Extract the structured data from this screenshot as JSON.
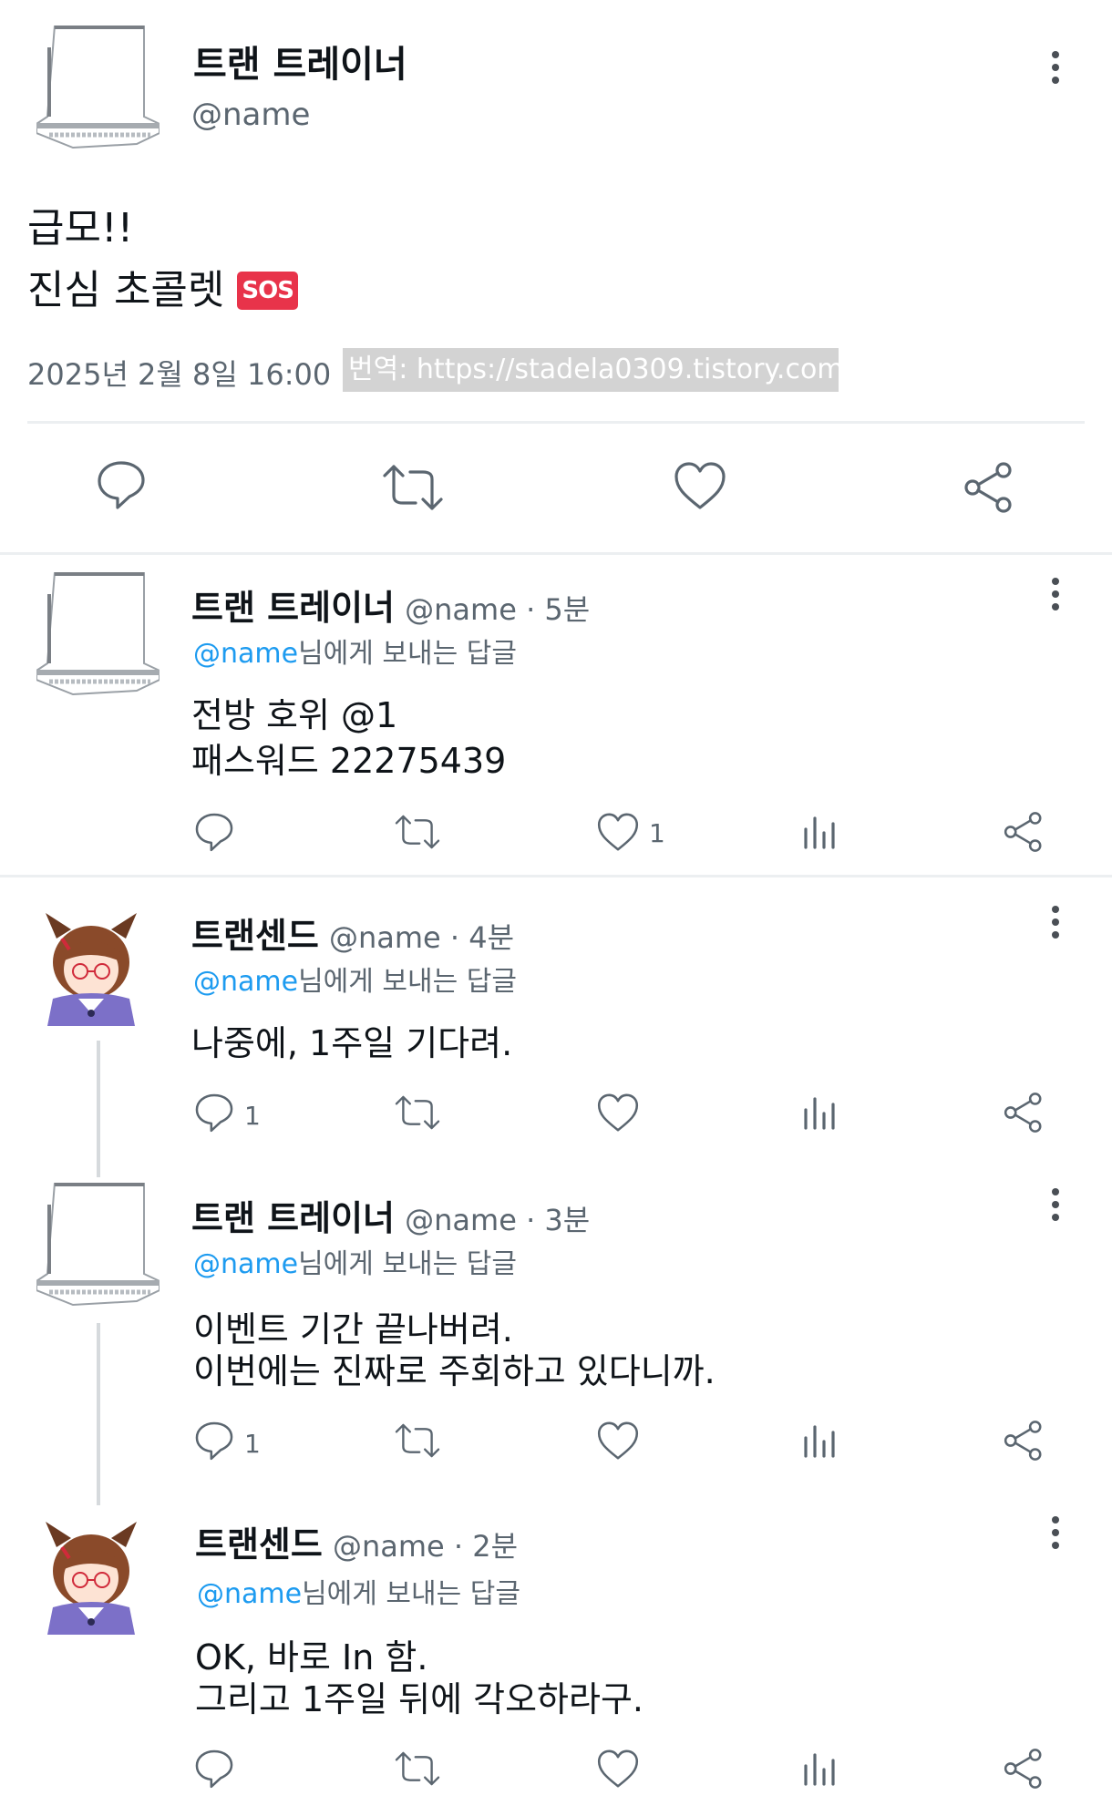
{
  "main_tweet": {
    "author_name": "트랜 트레이너",
    "author_handle": "@name",
    "text_line1": "급모!!",
    "text_line2": "진심 초콜렛",
    "sos_emoji": "SOS",
    "timestamp": "2025년 2월 8일 16:00",
    "watermark": "번역: https://stadela0309.tistory.com"
  },
  "replies": [
    {
      "author_name": "트랜 트레이너",
      "meta": "@name · 5분",
      "reply_to_handle": "@name",
      "reply_to_suffix": "님에게 보내는 답글",
      "line1": "전방 호위 @1",
      "line2": "패스워드 22275439",
      "reply_count": "",
      "like_count": "1"
    },
    {
      "author_name": "트랜센드",
      "meta": "@name · 4분",
      "reply_to_handle": "@name",
      "reply_to_suffix": "님에게 보내는 답글",
      "line1": "나중에, 1주일 기다려.",
      "line2": "",
      "reply_count": "1",
      "like_count": ""
    },
    {
      "author_name": "트랜 트레이너",
      "meta": "@name · 3분",
      "reply_to_handle": "@name",
      "reply_to_suffix": "님에게 보내는 답글",
      "line1": "이벤트 기간 끝나버려.",
      "line2": "이번에는 진짜로 주회하고 있다니까.",
      "reply_count": "1",
      "like_count": ""
    },
    {
      "author_name": "트랜센드",
      "meta": "@name · 2분",
      "reply_to_handle": "@name",
      "reply_to_suffix": "님에게 보내는 답글",
      "line1": "OK, 바로 In 함.",
      "line2": "그리고 1주일 뒤에 각오하라구.",
      "reply_count": "",
      "like_count": ""
    }
  ],
  "icons": {
    "reply": "reply-icon",
    "retweet": "retweet-icon",
    "like": "heart-icon",
    "views": "views-icon",
    "share": "share-icon",
    "more": "more-vertical-icon"
  },
  "colors": {
    "link_blue": "#1d9bf0",
    "secondary_text": "#5b6670",
    "sos_red": "#e8334a"
  }
}
